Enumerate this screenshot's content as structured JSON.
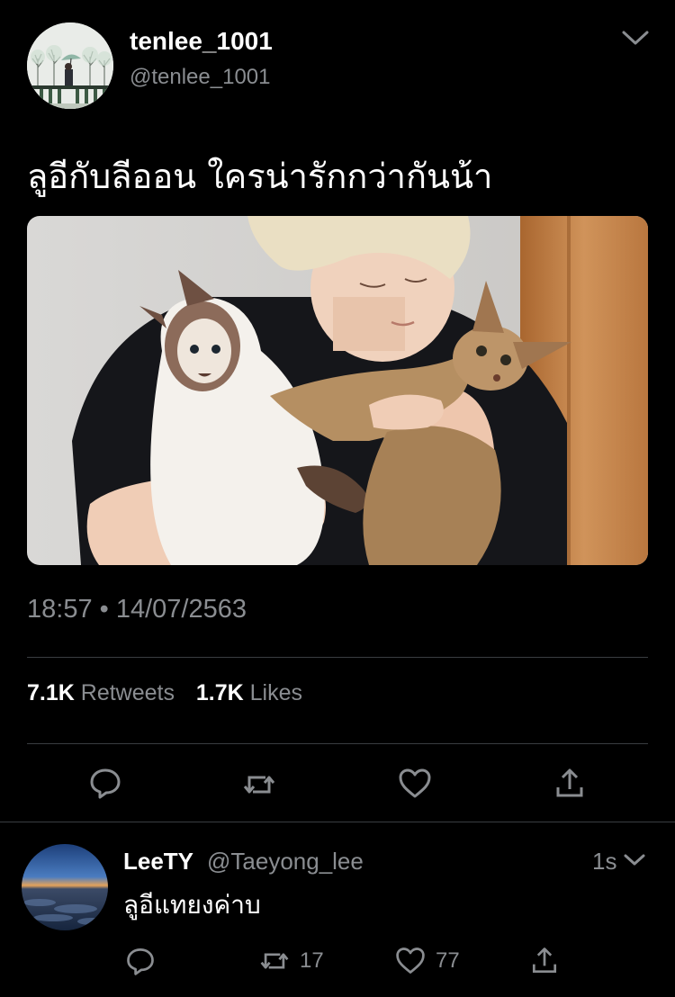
{
  "tweet": {
    "display_name": "tenlee_1001",
    "handle": "@tenlee_1001",
    "text": "ลูอีกับลีออน ใครน่ารักกว่ากันน้า",
    "timestamp": "18:57 • 14/07/2563",
    "stats": {
      "retweets_count": "7.1K",
      "retweets_label": "Retweets",
      "likes_count": "1.7K",
      "likes_label": "Likes"
    },
    "icons": [
      "reply-icon",
      "retweet-icon",
      "like-icon",
      "share-icon",
      "chevron-down-icon"
    ]
  },
  "reply": {
    "display_name": "LeeTY",
    "handle": "@Taeyong_lee",
    "time": "1s",
    "text": "ลูอีแทยงค่าบ",
    "retweet_count": "17",
    "like_count": "77"
  },
  "colors": {
    "background": "#000000",
    "primary_text": "#ffffff",
    "secondary_text": "#8a8d91",
    "divider": "#3a3d41"
  }
}
